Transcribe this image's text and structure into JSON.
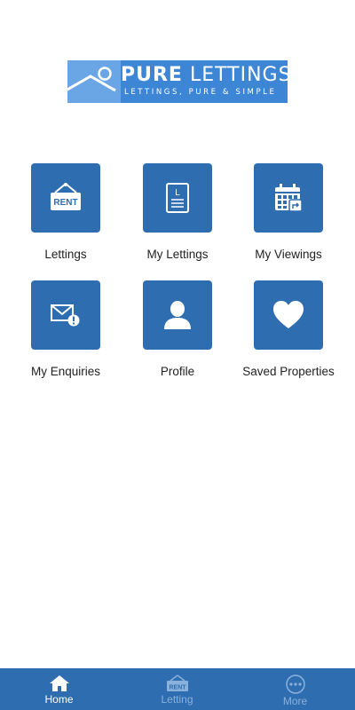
{
  "logo": {
    "brand_bold": "PURE",
    "brand_light": "LETTINGS",
    "tagline": "LETTINGS, PURE & SIMPLE"
  },
  "tiles": [
    {
      "label": "Lettings",
      "icon": "rent-sign-icon"
    },
    {
      "label": "My Lettings",
      "icon": "document-icon"
    },
    {
      "label": "My Viewings",
      "icon": "calendar-icon"
    },
    {
      "label": "My Enquiries",
      "icon": "envelope-alert-icon"
    },
    {
      "label": "Profile",
      "icon": "person-icon"
    },
    {
      "label": "Saved Properties",
      "icon": "heart-icon"
    }
  ],
  "icon_text": {
    "rent": "RENT",
    "doc_letter": "L"
  },
  "tabbar": {
    "tabs": [
      {
        "label": "Home",
        "icon": "home-icon",
        "active": true
      },
      {
        "label": "Letting",
        "icon": "rent-sign-icon",
        "active": false
      },
      {
        "label": "More",
        "icon": "more-icon",
        "active": false
      }
    ]
  },
  "colors": {
    "primary": "#2f6db1",
    "logo_bg": "#3d86d6",
    "inactive_tab": "#8ab1db"
  }
}
